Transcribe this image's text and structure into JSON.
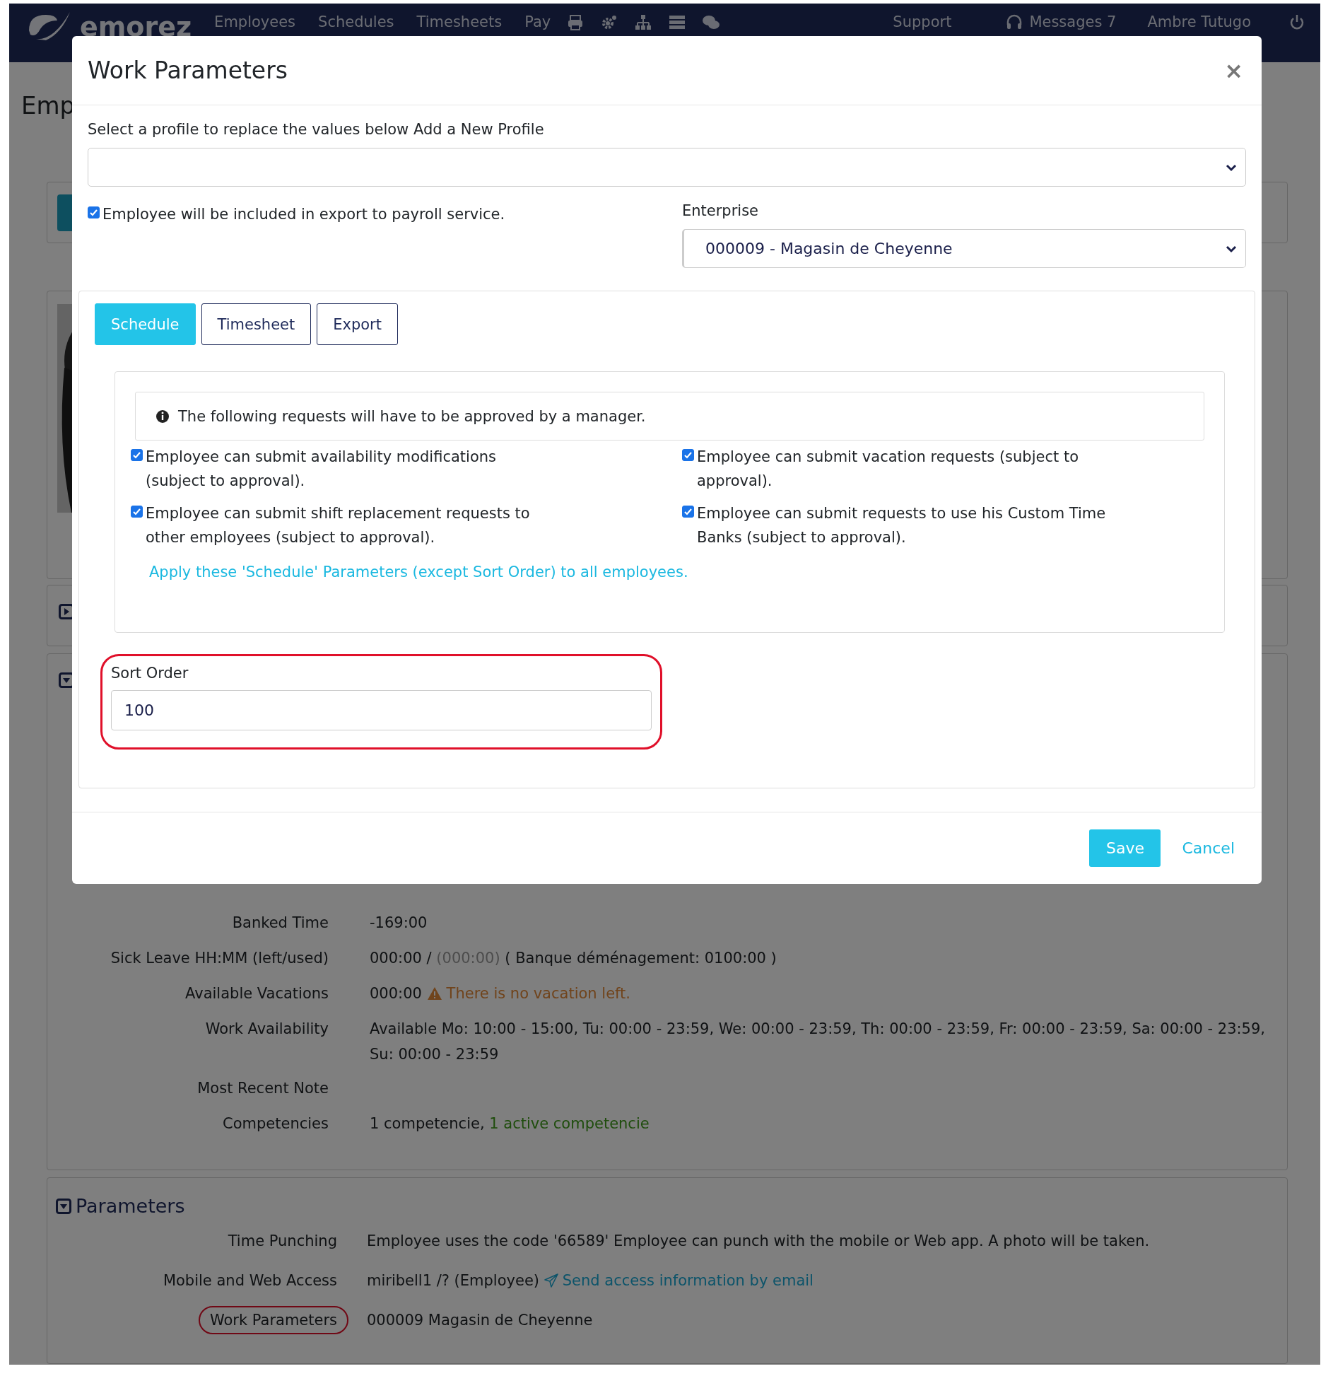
{
  "nav": {
    "logo": "emorez",
    "items": [
      "Employees",
      "Schedules",
      "Timesheets",
      "Pay"
    ],
    "support": "Support",
    "messages": "Messages 7",
    "user": "Ambre Tutugo"
  },
  "page_title": "Emp",
  "modal": {
    "title": "Work Parameters",
    "close": "×",
    "profile_label": "Select a profile to replace the values below Add a New Profile",
    "payroll": {
      "label": "Employee will be included in export to payroll service.",
      "checked": true
    },
    "enterprise_label": "Enterprise",
    "enterprise_value": "000009 - Magasin de Cheyenne",
    "tabs": [
      {
        "label": "Schedule",
        "selected": true
      },
      {
        "label": "Timesheet",
        "selected": false
      },
      {
        "label": "Export",
        "selected": false
      }
    ],
    "info": "The following requests will have to be approved by a manager.",
    "permissions": [
      {
        "label": "Employee can submit availability modifications (subject to approval).",
        "checked": true
      },
      {
        "label": "Employee can submit vacation requests (subject to approval).",
        "checked": true
      },
      {
        "label": "Employee can submit shift replacement requests to other employees (subject to approval).",
        "checked": true
      },
      {
        "label": "Employee can submit requests to use his Custom Time Banks (subject to approval).",
        "checked": true
      }
    ],
    "apply_link": "Apply these 'Schedule' Parameters (except Sort Order) to all employees.",
    "sort_order": {
      "label": "Sort Order",
      "value": "100",
      "highlighted": true
    },
    "save": "Save",
    "cancel": "Cancel"
  },
  "details": [
    {
      "label": "Banked Time",
      "value": [
        {
          "kind": "text",
          "text": "-169:00"
        }
      ]
    },
    {
      "label": "Sick Leave HH:MM (left/used)",
      "value": [
        {
          "kind": "text",
          "text": "000:00 /"
        },
        {
          "kind": "muted",
          "text": "(000:00)"
        },
        {
          "kind": "text",
          "text": "( Banque déménagement: 0100:00 )"
        }
      ]
    },
    {
      "label": "Available Vacations",
      "value": [
        {
          "kind": "text",
          "text": "000:00"
        },
        {
          "kind": "warning",
          "text": "There is no vacation left."
        }
      ]
    },
    {
      "label": "Work Availability",
      "value": [
        {
          "kind": "text",
          "text": "Available Mo: 10:00 - 15:00, Tu: 00:00 - 23:59, We: 00:00 - 23:59, Th: 00:00 - 23:59, Fr: 00:00 - 23:59, Sa: 00:00 - 23:59, Su: 00:00 - 23:59"
        }
      ]
    },
    {
      "label": "Most Recent Note"
    },
    {
      "label": "Competencies",
      "value": [
        {
          "kind": "text",
          "text": "1 competencie,"
        },
        {
          "kind": "success",
          "text": "1 active competencie"
        }
      ]
    }
  ],
  "parameters": {
    "title": "Parameters",
    "rows": [
      {
        "label": "Time Punching",
        "highlighted": false,
        "value": [
          {
            "kind": "text",
            "text": "Employee uses the code '66589' Employee can punch with the mobile or Web app. A photo will be taken."
          }
        ]
      },
      {
        "label": "Mobile and Web Access",
        "highlighted": false,
        "value": [
          {
            "kind": "text",
            "text": "miribell1 /? (Employee)"
          },
          {
            "kind": "link",
            "text": "Send access information by email"
          }
        ]
      },
      {
        "label": "Work Parameters",
        "highlighted": true,
        "value": [
          {
            "kind": "text",
            "text": "000009 Magasin de Cheyenne"
          }
        ]
      }
    ]
  }
}
